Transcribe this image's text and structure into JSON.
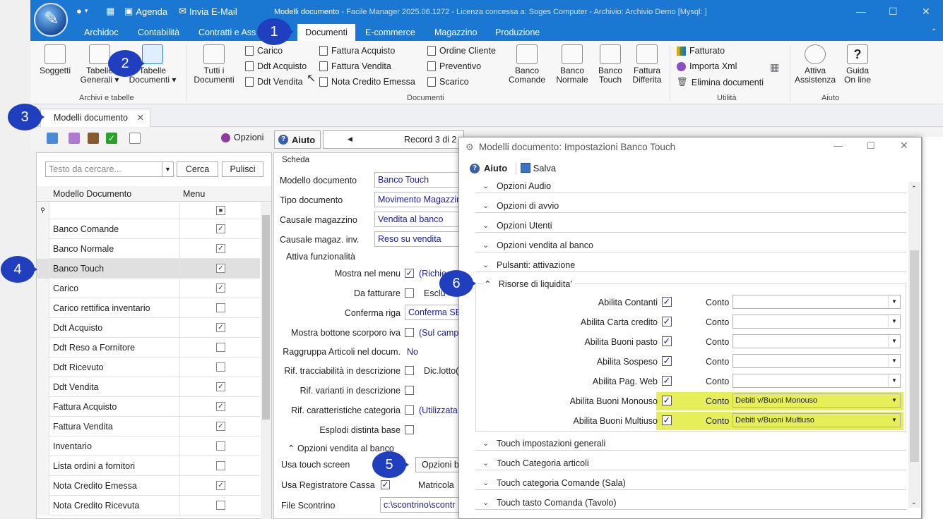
{
  "app": {
    "title": "Modelli documento",
    "title_rest": " - Facile Manager 2025.06.1272 - Licenza concessa a: Soges Computer - Archivio: Archivio Demo  [Mysql: ]",
    "quick_access": {
      "agenda": "Agenda",
      "invia_email": "Invia E-Mail"
    },
    "window_controls": {
      "minimize": "—",
      "maximize": "☐",
      "close": "✕"
    }
  },
  "ribbon_tabs": [
    "Archidoc",
    "Contabilità",
    "Contratti e Ass",
    "Documenti",
    "E-commerce",
    "Magazzino",
    "Produzione"
  ],
  "ribbon": {
    "archivi": {
      "soggetti": "Soggetti",
      "tabelle_generali_1": "Tabelle",
      "tabelle_generali_2": "Generali ▾",
      "tabelle_documenti_1": "Tabelle",
      "tabelle_documenti_2": "Documenti ▾",
      "group": "Archivi e tabelle"
    },
    "documenti": {
      "tutti_1": "Tutti i",
      "tutti_2": "Documenti",
      "col1": [
        "Carico",
        "Ddt Acquisto",
        "Ddt Vendita"
      ],
      "col2": [
        "Fattura Acquisto",
        "Fattura Vendita",
        "Nota Credito Emessa"
      ],
      "col3": [
        "Ordine Cliente",
        "Preventivo",
        "Scarico"
      ],
      "banco_comande_1": "Banco",
      "banco_comande_2": "Comande",
      "banco_normale_1": "Banco",
      "banco_normale_2": "Normale",
      "banco_touch_1": "Banco",
      "banco_touch_2": "Touch",
      "fattura_differita_1": "Fattura",
      "fattura_differita_2": "Differita",
      "group": "Documenti"
    },
    "utilita": {
      "items": [
        "Fatturato",
        "Importa Xml",
        "Elimina documenti"
      ],
      "group": "Utilità"
    },
    "aiuto": {
      "attiva_1": "Attiva",
      "attiva_2": "Assistenza",
      "guida_1": "Guida",
      "guida_2": "On line",
      "group": "Aiuto"
    }
  },
  "doc_tab": {
    "label": "Modelli documento",
    "close": "✕"
  },
  "toolbar": {
    "opzioni": "Opzioni",
    "aiuto": "Aiuto",
    "record": "Record 3 di 2"
  },
  "left": {
    "search_placeholder": "Testo da cercare...",
    "cerca": "Cerca",
    "pulisci": "Pulisci",
    "col_modello": "Modello Documento",
    "col_menu": "Menu",
    "rows": [
      {
        "name": "Banco Comande",
        "menu": "✓"
      },
      {
        "name": "Banco Normale",
        "menu": "✓"
      },
      {
        "name": "Banco Touch",
        "menu": "✓"
      },
      {
        "name": "Carico",
        "menu": "✓"
      },
      {
        "name": "Carico rettifica inventario",
        "menu": ""
      },
      {
        "name": "Ddt Acquisto",
        "menu": "✓"
      },
      {
        "name": "Ddt Reso a Fornitore",
        "menu": ""
      },
      {
        "name": "Ddt Ricevuto",
        "menu": ""
      },
      {
        "name": "Ddt Vendita",
        "menu": "✓"
      },
      {
        "name": "Fattura Acquisto",
        "menu": "✓"
      },
      {
        "name": "Fattura Vendita",
        "menu": "✓"
      },
      {
        "name": "Inventario",
        "menu": ""
      },
      {
        "name": "Lista ordini a fornitori",
        "menu": ""
      },
      {
        "name": "Nota Credito Emessa",
        "menu": "✓"
      },
      {
        "name": "Nota Credito Ricevuta",
        "menu": ""
      }
    ]
  },
  "form": {
    "scheda": "Scheda",
    "modello_label": "Modello documento",
    "modello_value": "Banco Touch",
    "tipo_label": "Tipo documento",
    "tipo_value": "Movimento Magazzino",
    "causale_label": "Causale magazzino",
    "causale_value": "Vendita al banco",
    "causale_inv_label": "Causale magaz. inv.",
    "causale_inv_value": "Reso su vendita",
    "attiva_funzionalita": "Attiva funzionalità",
    "mostra_menu": "Mostra nel menu",
    "mostra_menu_note": "(Richie",
    "da_fatturare": "Da fatturare",
    "escludi": "Esclu",
    "conferma_riga": "Conferma riga",
    "conferma_riga_value": "Conferma SE",
    "mostra_scorporo": "Mostra bottone scorporo iva",
    "scorporo_note": "(Sul camp",
    "raggruppa": "Raggruppa Articoli nel docum.",
    "raggruppa_value": "No",
    "rif_tracc": "Rif. tracciabilità in descrizione",
    "dic_lotto": "Dic.lotto(",
    "rif_varianti": "Rif. varianti in descrizione",
    "rif_caratt": "Rif. caratteristiche categoria",
    "caratt_note": "(Utilizzata",
    "esplodi": "Esplodi distinta base",
    "opzioni_vendita": "Opzioni vendita al banco",
    "usa_touch": "Usa touch screen",
    "opzioni_btn": "Opzioni b",
    "usa_registratore": "Usa Registratore Cassa",
    "matricola": "Matricola",
    "file_scontrino": "File Scontrino",
    "file_scontrino_value": "c:\\scontrino\\scontr"
  },
  "dialog": {
    "title": "Modelli documento: Impostazioni Banco Touch",
    "aiuto": "Aiuto",
    "salva": "Salva",
    "sections_top": [
      "Opzioni Audio",
      "Opzioni di avvio",
      "Opzioni Utenti",
      "Opzioni vendita al banco",
      "Pulsanti: attivazione"
    ],
    "risorse": "Risorse di liquidita'",
    "conto": "Conto",
    "rows": [
      {
        "label": "Abilita Contanti",
        "value": ""
      },
      {
        "label": "Abilita Carta credito",
        "value": ""
      },
      {
        "label": "Abilita Buoni pasto",
        "value": ""
      },
      {
        "label": "Abilita Sospeso",
        "value": ""
      },
      {
        "label": "Abilita Pag. Web",
        "value": ""
      },
      {
        "label": "Abilita Buoni Monouso",
        "value": "Debiti v/Buoni Monouso"
      },
      {
        "label": "Abilita Buoni Multiuso",
        "value": "Debiti v/Buoni Multiuso"
      }
    ],
    "sections_bottom": [
      "Touch  impostazioni generali",
      "Touch Categoria articoli",
      "Touch categoria Comande (Sala)",
      "Touch tasto Comanda (Tavolo)"
    ]
  },
  "callouts": [
    "1",
    "2",
    "3",
    "4",
    "5",
    "6"
  ],
  "colors": {
    "accent": "#1a77d2",
    "callout": "#1f3fbf",
    "highlight": "#e6ee5a",
    "value_text": "#1a1aa0"
  }
}
